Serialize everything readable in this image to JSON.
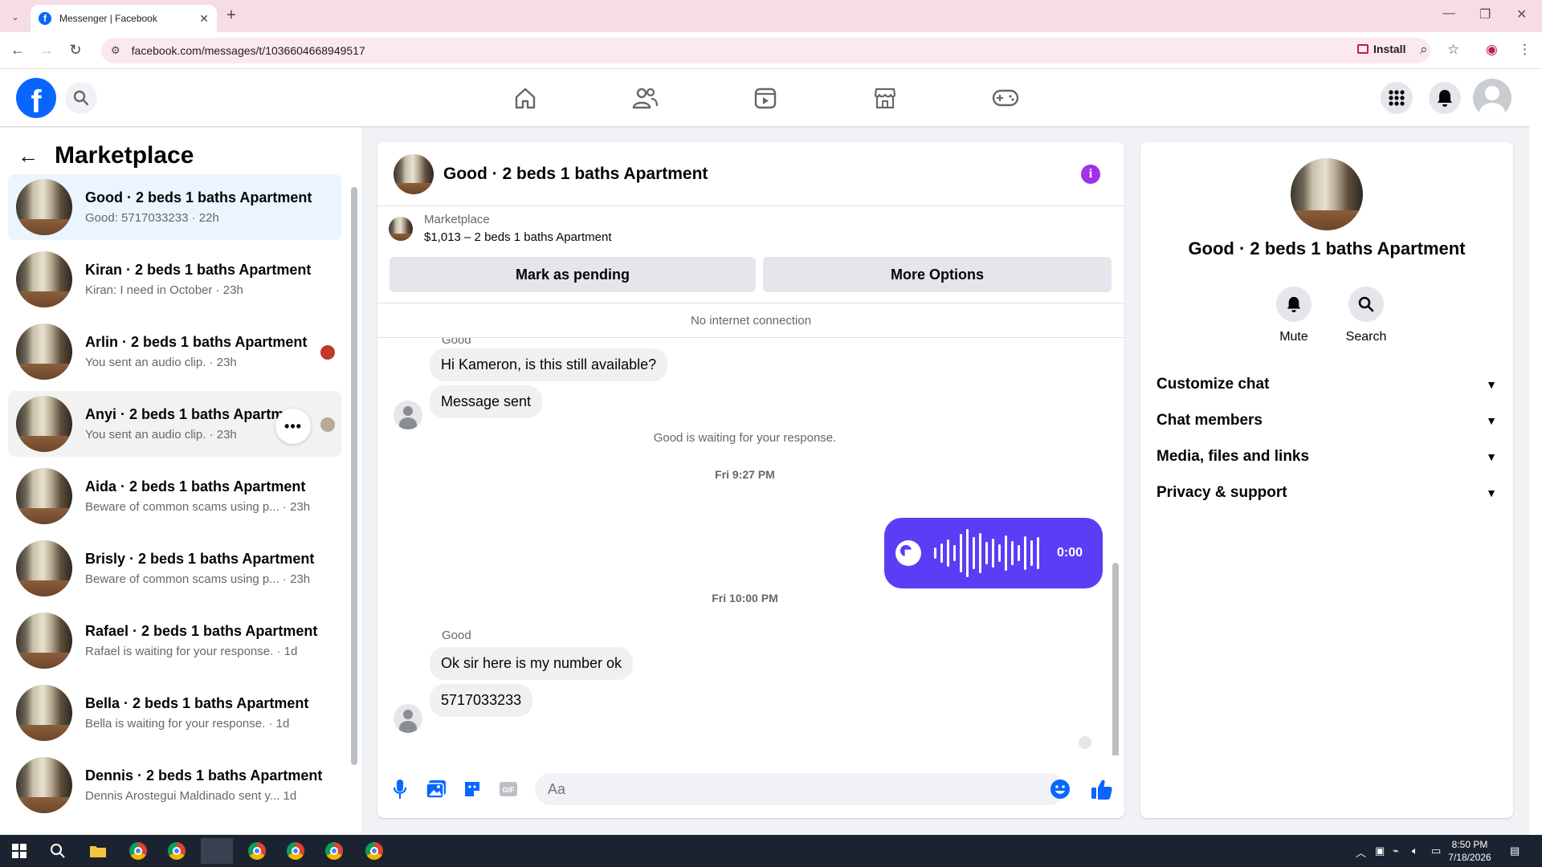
{
  "browser": {
    "tab_title": "Messenger | Facebook",
    "url": "facebook.com/messages/t/1036604668949517",
    "install_label": "Install"
  },
  "fb": {
    "logo": "f",
    "nav_icons": [
      "home-icon",
      "friends-icon",
      "video-icon",
      "marketplace-icon",
      "gaming-icon"
    ]
  },
  "sidebar": {
    "title": "Marketplace",
    "conversations": [
      {
        "name": "Good · 2 beds 1 baths Apartment",
        "preview": "Good: 5717033233 · 22h"
      },
      {
        "name": "Kiran · 2 beds 1 baths Apartment",
        "preview": "Kiran: I need in October · 23h"
      },
      {
        "name": "Arlin · 2 beds 1 baths Apartment",
        "preview": "You sent an audio clip. · 23h"
      },
      {
        "name": "Anyi · 2 beds 1 baths Apartm",
        "preview": "You sent an audio clip. · 23h"
      },
      {
        "name": "Aida · 2 beds 1 baths Apartment",
        "preview": "Beware of common scams using p... · 23h"
      },
      {
        "name": "Brisly · 2 beds 1 baths Apartment",
        "preview": "Beware of common scams using p... · 23h"
      },
      {
        "name": "Rafael · 2 beds 1 baths Apartment",
        "preview": "Rafael is waiting for your response. · 1d"
      },
      {
        "name": "Bella · 2 beds 1 baths Apartment",
        "preview": "Bella is waiting for your response. · 1d"
      },
      {
        "name": "Dennis · 2 beds 1 baths Apartment",
        "preview": "Dennis Arostegui Maldinado sent y...   1d"
      }
    ]
  },
  "chat": {
    "title": "Good · 2 beds 1 baths Apartment",
    "marketplace_label": "Marketplace",
    "listing": "$1,013 – 2 beds 1 baths Apartment",
    "mark_pending": "Mark as pending",
    "more_options": "More Options",
    "no_internet": "No internet connection",
    "sender_top": "Good",
    "msg1": "Hi Kameron, is this still available?",
    "msg2": "Message sent",
    "waiting": "Good is waiting for your response.",
    "time1": "Fri 9:27 PM",
    "audio_time": "0:00",
    "time2": "Fri 10:00 PM",
    "sender2": "Good",
    "msg3": "Ok sir here is my number ok",
    "msg4": "5717033233",
    "input_placeholder": "Aa"
  },
  "info": {
    "name": "Good · 2 beds 1 baths Apartment",
    "mute": "Mute",
    "search": "Search",
    "sections": [
      "Customize chat",
      "Chat members",
      "Media, files and links",
      "Privacy & support"
    ]
  },
  "taskbar": {
    "time": "8:50 PM",
    "date": "7/18/2026"
  },
  "colors": {
    "fb_blue": "#0866ff",
    "audio_bubble": "#5b3df5",
    "info_purple": "#a033e8"
  }
}
